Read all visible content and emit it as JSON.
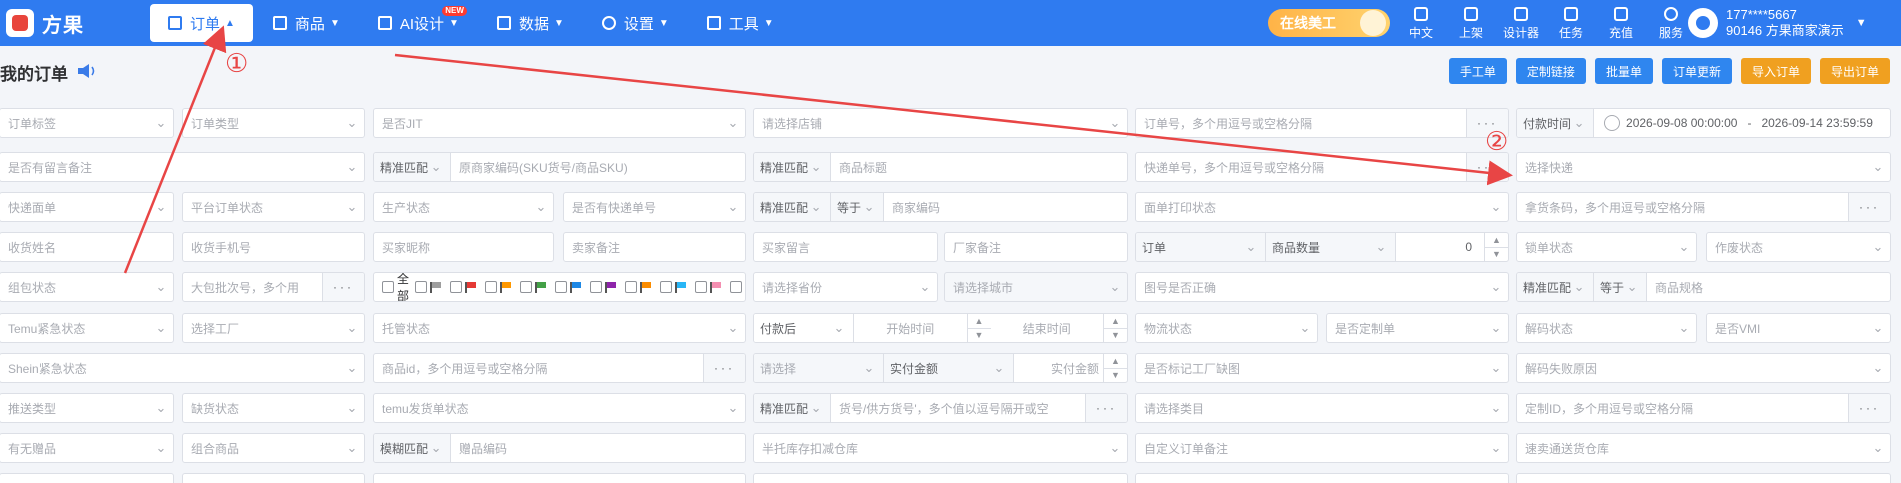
{
  "app": {
    "brand": "方果"
  },
  "nav": [
    {
      "label": "订单",
      "icon": "clipboard-icon",
      "active": true
    },
    {
      "label": "商品",
      "icon": "product-icon"
    },
    {
      "label": "AI设计",
      "icon": "ai-icon",
      "badge": "NEW"
    },
    {
      "label": "数据",
      "icon": "chart-icon"
    },
    {
      "label": "设置",
      "icon": "gear-icon"
    },
    {
      "label": "工具",
      "icon": "cube-icon"
    }
  ],
  "promo": {
    "label": "在线美工"
  },
  "tools": [
    {
      "label": "中文",
      "icon": "language-icon"
    },
    {
      "label": "上架",
      "icon": "upload-icon"
    },
    {
      "label": "设计器",
      "icon": "image-icon"
    },
    {
      "label": "任务",
      "icon": "task-icon"
    },
    {
      "label": "充值",
      "icon": "recharge-icon"
    },
    {
      "label": "服务",
      "icon": "service-icon"
    }
  ],
  "user": {
    "phone": "177****5667",
    "account": "90146 方果商家演示"
  },
  "page": {
    "title": "我的订单"
  },
  "actions": [
    {
      "label": "手工单",
      "color": "#2f86ef"
    },
    {
      "label": "定制链接",
      "color": "#2f86ef"
    },
    {
      "label": "批量单",
      "color": "#2f86ef"
    },
    {
      "label": "订单更新",
      "color": "#2f86ef"
    },
    {
      "label": "导入订单",
      "color": "#f0a020"
    },
    {
      "label": "导出订单",
      "color": "#f0a020"
    }
  ],
  "filters": {
    "order_tag": "订单标签",
    "order_type": "订单类型",
    "is_jit": "是否JIT",
    "store": "请选择店铺",
    "order_no": "订单号，多个用逗号或空格分隔",
    "time_type": "付款时间",
    "date_start": "2026-09-08 00:00:00",
    "date_sep": "-",
    "date_end": "2026-09-14 23:59:59",
    "has_note": "是否有留言备注",
    "match_exact": "精准匹配",
    "match_fuzzy": "模糊匹配",
    "sku_code": "原商家编码(SKU货号/商品SKU)",
    "product_title": "商品标题",
    "tracking_no": "快递单号，多个用逗号或空格分隔",
    "courier": "选择快递",
    "express_sheet": "快递面单",
    "platform_status": "平台订单状态",
    "production_status": "生产状态",
    "has_tracking": "是否有快递单号",
    "equals": "等于",
    "merchant_code": "商家编码",
    "print_status": "面单打印状态",
    "pick_barcode": "拿货条码，多个用逗号或空格分隔",
    "receiver_name": "收货姓名",
    "receiver_phone": "收货手机号",
    "buyer_nick": "买家昵称",
    "seller_note": "卖家备注",
    "buyer_message": "买家留言",
    "factory_note": "厂家备注",
    "order_dim": "订单",
    "qty_dim": "商品数量",
    "qty_value": "0",
    "lock_status": "锁单状态",
    "void_status": "作废状态",
    "group_status": "组包状态",
    "bulk_pack_no": "大包批次号，多个用",
    "flags_all": "全部",
    "province": "请选择省份",
    "city": "请选择城市",
    "image_correct": "图号是否正确",
    "sku_spec": "商品规格",
    "temu_urgent": "Temu紧急状态",
    "factory": "选择工厂",
    "hosting_status": "托管状态",
    "after_pay": "付款后",
    "start_time": "开始时间",
    "end_time": "结束时间",
    "logistics_status": "物流状态",
    "is_custom": "是否定制单",
    "decode_status": "解码状态",
    "is_vmi": "是否VMI",
    "shein_urgent": "Shein紧急状态",
    "product_id": "商品id，多个用逗号或空格分隔",
    "please_select": "请选择",
    "actual_amount": "实付金额",
    "actual_amount_input": "实付金额",
    "factory_missing_img": "是否标记工厂缺图",
    "decode_fail_reason": "解码失败原因",
    "push_type": "推送类型",
    "stockout_status": "缺货状态",
    "temu_ship_status": "temu发货单状态",
    "supplier_sku": "货号/供方货号'，多个值以逗号隔开或空",
    "category": "请选择类目",
    "custom_id": "定制ID，多个用逗号或空格分隔",
    "has_gift": "有无赠品",
    "combo_product": "组合商品",
    "gift_code": "赠品编码",
    "semi_hosted_wh": "半托库存扣减仓库",
    "custom_order_note": "自定义订单备注",
    "fast_sell_wh": "速卖通送货仓库"
  },
  "flag_colors": [
    "#9e9e9e",
    "#e53935",
    "#ff9800",
    "#43a047",
    "#1e88e5",
    "#8e24aa",
    "#fb8c00",
    "#29b6f6",
    "#f48fb1",
    "#c0a000"
  ],
  "annotations": {
    "marker_1": "①",
    "marker_2": "②",
    "color": "#e84545"
  }
}
